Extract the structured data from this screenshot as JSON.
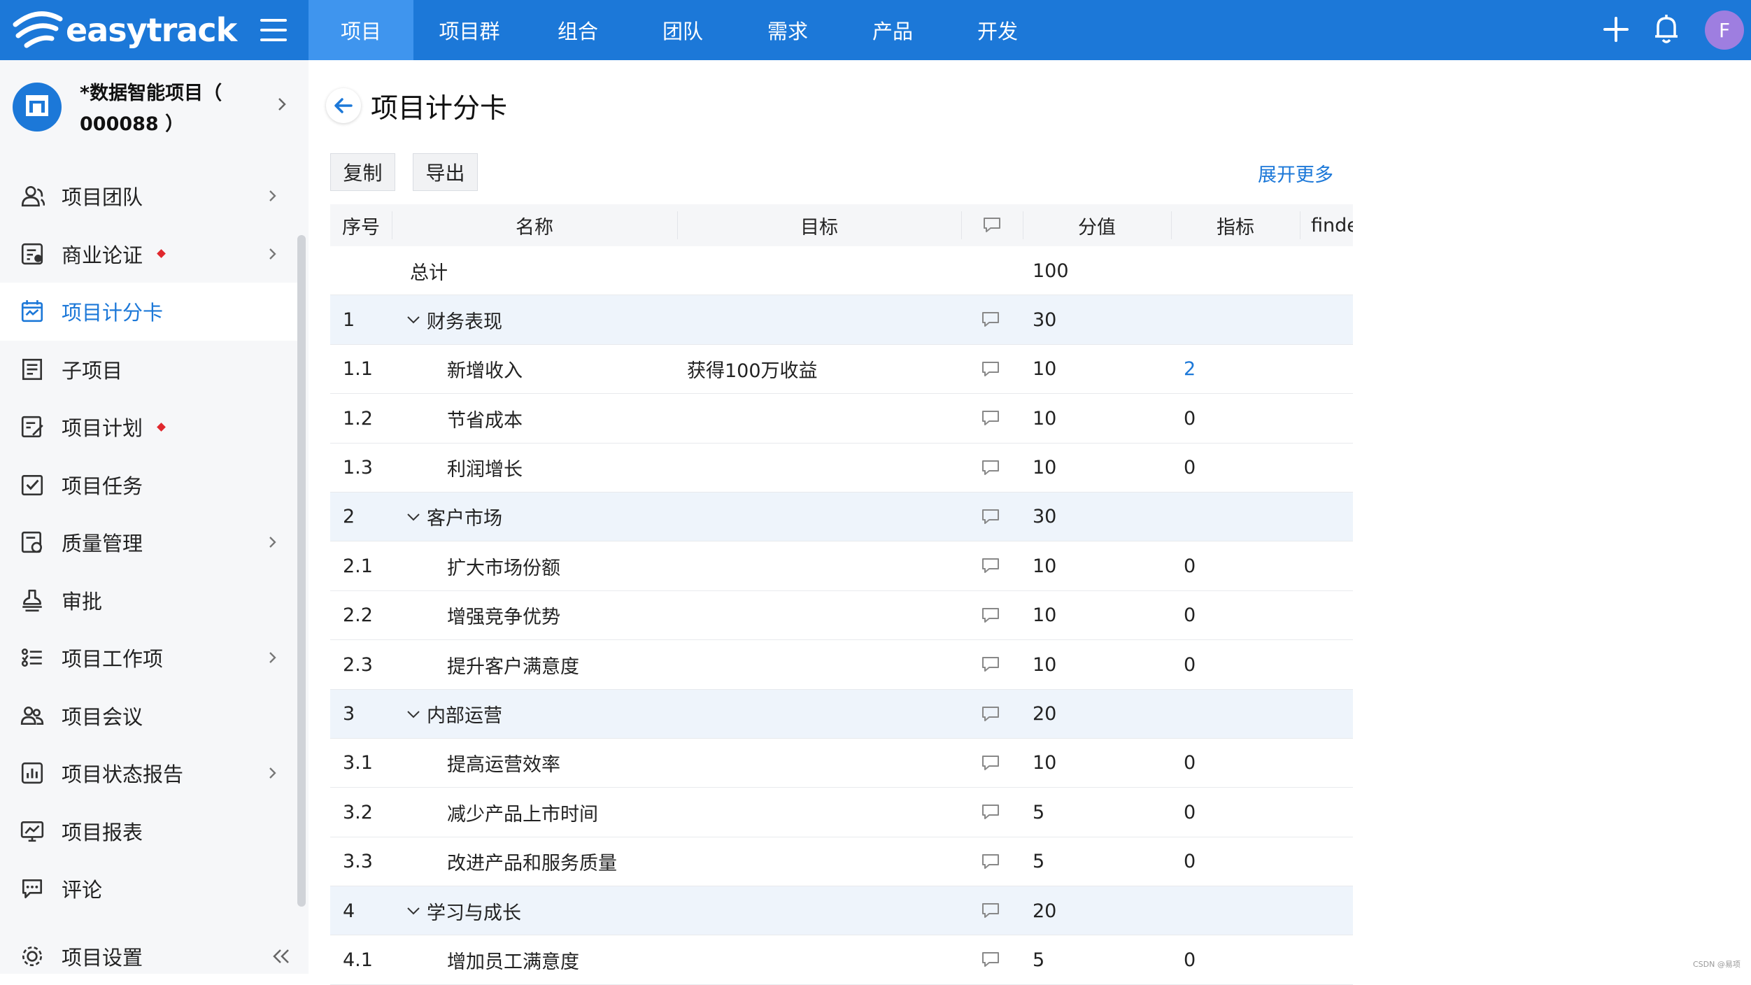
{
  "app": {
    "logo_text": "easytrack",
    "avatar_letter": "F"
  },
  "nav": {
    "items": [
      "项目",
      "项目群",
      "组合",
      "团队",
      "需求",
      "产品",
      "开发"
    ],
    "active": 0
  },
  "project": {
    "name": "*数据智能项目（ 000088 ）"
  },
  "sidebar": {
    "items": [
      {
        "label": "项目团队",
        "icon": "team-icon",
        "chevron": true,
        "dot": false
      },
      {
        "label": "商业论证",
        "icon": "business-case-icon",
        "chevron": true,
        "dot": true
      },
      {
        "label": "项目计分卡",
        "icon": "scorecard-icon",
        "chevron": false,
        "dot": false,
        "active": true
      },
      {
        "label": "子项目",
        "icon": "subproject-icon",
        "chevron": false,
        "dot": false
      },
      {
        "label": "项目计划",
        "icon": "plan-icon",
        "chevron": false,
        "dot": true
      },
      {
        "label": "项目任务",
        "icon": "task-icon",
        "chevron": false,
        "dot": false
      },
      {
        "label": "质量管理",
        "icon": "quality-icon",
        "chevron": true,
        "dot": false
      },
      {
        "label": "审批",
        "icon": "approval-icon",
        "chevron": false,
        "dot": false
      },
      {
        "label": "项目工作项",
        "icon": "work-items-icon",
        "chevron": true,
        "dot": false
      },
      {
        "label": "项目会议",
        "icon": "meeting-icon",
        "chevron": false,
        "dot": false
      },
      {
        "label": "项目状态报告",
        "icon": "status-report-icon",
        "chevron": true,
        "dot": false
      },
      {
        "label": "项目报表",
        "icon": "report-icon",
        "chevron": false,
        "dot": false
      },
      {
        "label": "评论",
        "icon": "comment-icon",
        "chevron": false,
        "dot": false
      },
      {
        "label": "项目设置",
        "icon": "settings-icon",
        "chevron": false,
        "dot": false
      }
    ]
  },
  "page": {
    "title": "项目计分卡",
    "buttons": {
      "copy": "复制",
      "export": "导出"
    },
    "expand_more": "展开更多"
  },
  "table": {
    "headers": {
      "seq": "序号",
      "name": "名称",
      "target": "目标",
      "score": "分值",
      "indicator": "指标",
      "extra": "finde"
    },
    "total": {
      "label": "总计",
      "score": "100"
    },
    "rows": [
      {
        "seq": "1",
        "name": "财务表现",
        "target": "",
        "score": "30",
        "indicator": "",
        "group": true
      },
      {
        "seq": "1.1",
        "name": "新增收入",
        "target": "获得100万收益",
        "score": "10",
        "indicator": "2",
        "group": false,
        "link": true
      },
      {
        "seq": "1.2",
        "name": "节省成本",
        "target": "",
        "score": "10",
        "indicator": "0",
        "group": false
      },
      {
        "seq": "1.3",
        "name": "利润增长",
        "target": "",
        "score": "10",
        "indicator": "0",
        "group": false
      },
      {
        "seq": "2",
        "name": "客户市场",
        "target": "",
        "score": "30",
        "indicator": "",
        "group": true
      },
      {
        "seq": "2.1",
        "name": "扩大市场份额",
        "target": "",
        "score": "10",
        "indicator": "0",
        "group": false
      },
      {
        "seq": "2.2",
        "name": "增强竞争优势",
        "target": "",
        "score": "10",
        "indicator": "0",
        "group": false
      },
      {
        "seq": "2.3",
        "name": "提升客户满意度",
        "target": "",
        "score": "10",
        "indicator": "0",
        "group": false
      },
      {
        "seq": "3",
        "name": "内部运营",
        "target": "",
        "score": "20",
        "indicator": "",
        "group": true
      },
      {
        "seq": "3.1",
        "name": "提高运营效率",
        "target": "",
        "score": "10",
        "indicator": "0",
        "group": false
      },
      {
        "seq": "3.2",
        "name": "减少产品上市时间",
        "target": "",
        "score": "5",
        "indicator": "0",
        "group": false
      },
      {
        "seq": "3.3",
        "name": "改进产品和服务质量",
        "target": "",
        "score": "5",
        "indicator": "0",
        "group": false
      },
      {
        "seq": "4",
        "name": "学习与成长",
        "target": "",
        "score": "20",
        "indicator": "",
        "group": true
      },
      {
        "seq": "4.1",
        "name": "增加员工满意度",
        "target": "",
        "score": "5",
        "indicator": "0",
        "group": false
      }
    ]
  },
  "watermark": "CSDN @易项",
  "colors": {
    "primary": "#1c78d8",
    "nav_active": "#3f95ee",
    "dot": "#e0282e",
    "group_row": "#eef4fb"
  }
}
